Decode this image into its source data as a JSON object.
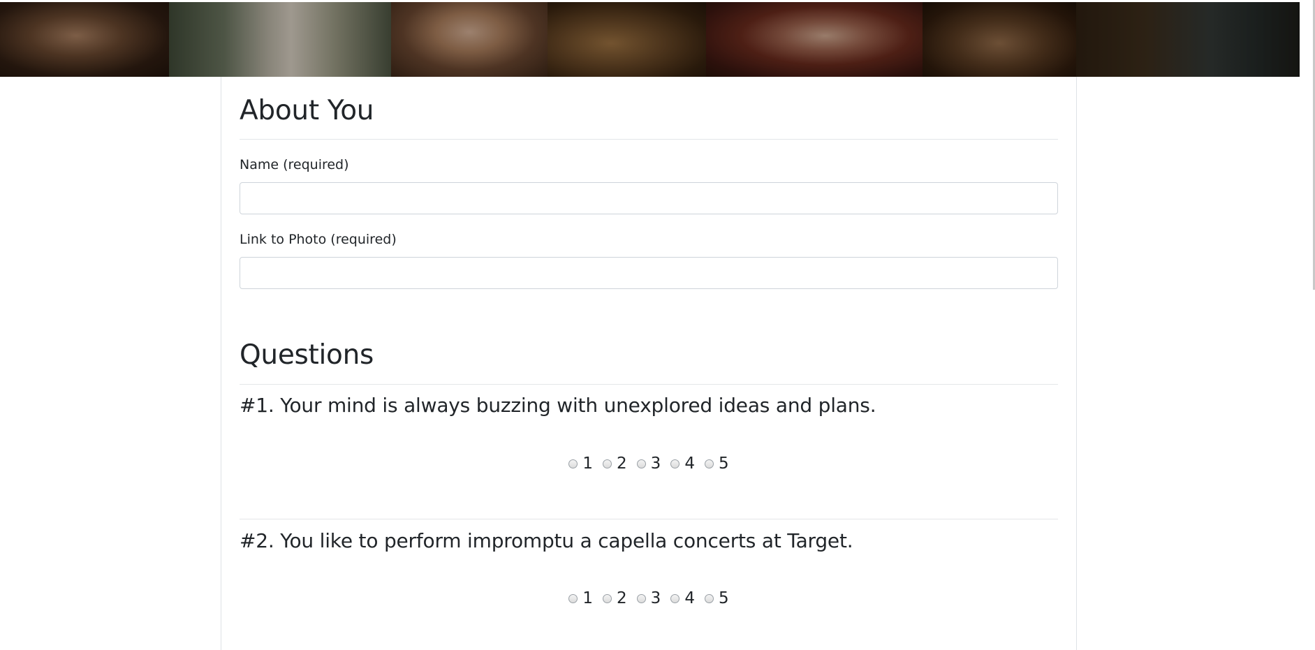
{
  "banner": {
    "panels": [
      "photo-1",
      "photo-2",
      "photo-3",
      "photo-4",
      "photo-5",
      "photo-6",
      "photo-7"
    ]
  },
  "about": {
    "title": "About You",
    "name_label": "Name (required)",
    "name_value": "",
    "photo_label": "Link to Photo (required)",
    "photo_value": ""
  },
  "questions_section": {
    "title": "Questions",
    "items": [
      {
        "title": "#1. Your mind is always buzzing with unexplored ideas and plans.",
        "options": [
          "1",
          "2",
          "3",
          "4",
          "5"
        ]
      },
      {
        "title": "#2. You like to perform impromptu a capella concerts at Target.",
        "options": [
          "1",
          "2",
          "3",
          "4",
          "5"
        ]
      }
    ]
  },
  "colors": {
    "text": "#212529",
    "border": "#ced4da",
    "divider": "#e3e6e8"
  }
}
